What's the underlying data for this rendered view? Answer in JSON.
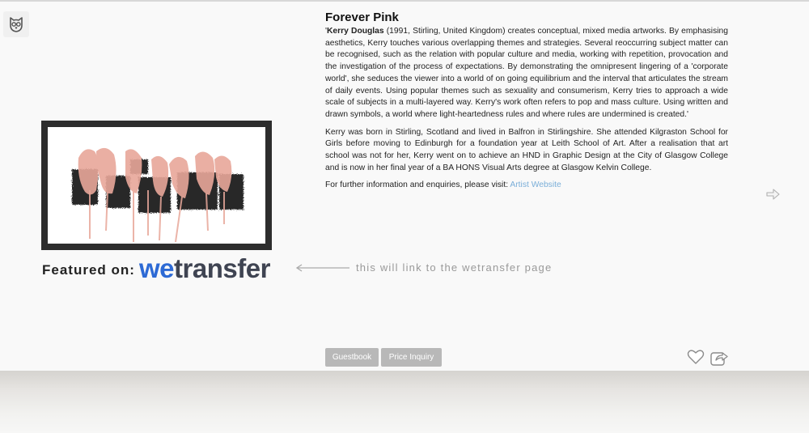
{
  "artwork": {
    "title": "Forever Pink"
  },
  "bio": {
    "quote_open": "'",
    "artist_name": "Kerry Douglas",
    "p1_rest": " (1991, Stirling, United Kingdom) creates conceptual, mixed media artworks. By emphasising aesthetics, Kerry touches various overlapping themes and strategies. Several reoccurring subject matter can be recognised, such as the relation with popular culture and media, working with repetition, provocation and the investigation of the process of expectations. By demonstrating the omnipresent lingering of a 'corporate world', she seduces the viewer into a world of on going equilibrium and the interval that articulates the stream of daily events. Using popular themes such as sexuality and consumerism, Kerry tries to approach a wide scale of subjects in a multi-layered way. Kerry's work often refers to pop and mass culture. Using written and drawn symbols, a world where light-heartedness rules and where rules are undermined is created.'",
    "p2": "Kerry was born in Stirling, Scotland and lived in Balfron in Stirlingshire. She attended Kilgraston School for Girls before moving to Edinburgh for a foundation year at Leith School of Art. After a realisation that art school was not for her, Kerry went on to achieve an HND in Graphic Design at the City of Glasgow College and is now in her final year of a BA HONS Visual Arts degree at Glasgow Kelvin College.",
    "p3_text": "For further information and enquiries, please visit: ",
    "p3_link": "Artist Website"
  },
  "featured": {
    "label": "Featured on:",
    "brand_we": "we",
    "brand_rest": "transfer",
    "note": "this will link to the wetransfer page"
  },
  "buttons": {
    "guestbook": "Guestbook",
    "price_inquiry": "Price Inquiry"
  },
  "icons": {
    "logo": "owl-logo-icon",
    "next": "arrow-right-icon",
    "like": "heart-icon",
    "share": "share-icon",
    "annotation_arrow": "arrow-left-icon"
  },
  "colors": {
    "link": "#7aaed8",
    "brand_blue": "#2d6ad5",
    "button_gray": "#b8b8b8",
    "frame": "#2d2d2d"
  }
}
